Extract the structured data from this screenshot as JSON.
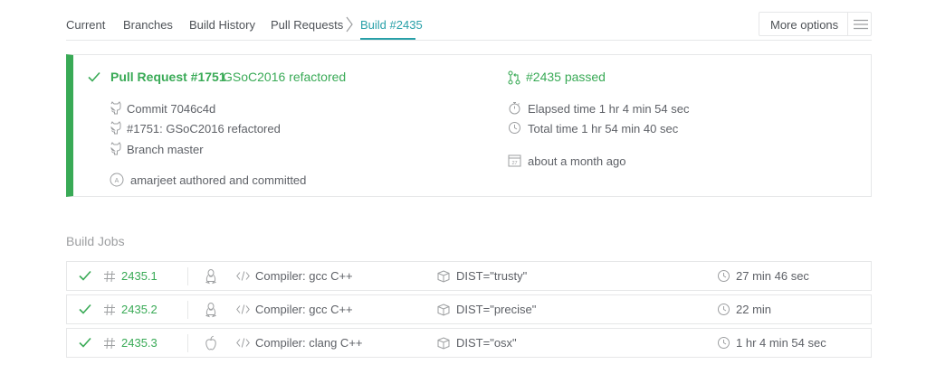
{
  "nav": {
    "tabs": [
      {
        "label": "Current"
      },
      {
        "label": "Branches"
      },
      {
        "label": "Build History"
      },
      {
        "label": "Pull Requests"
      },
      {
        "label": "Build #2435"
      }
    ],
    "active_tab": "Build #2435",
    "more_options_label": "More options"
  },
  "build": {
    "pr_number": "Pull Request #1751",
    "pr_message": "GSoC2016 refactored",
    "commit": "Commit 7046c4d",
    "pr_ref": "#1751: GSoC2016 refactored",
    "branch": "Branch master",
    "author": "amarjeet authored and committed",
    "status": "#2435 passed",
    "elapsed": "Elapsed time 1 hr 4 min 54 sec",
    "total": "Total time 1 hr 54 min 40 sec",
    "when": "about a month ago",
    "author_avatar_letter": "A",
    "calendar_day": "27"
  },
  "jobs_heading": "Build Jobs",
  "jobs": [
    {
      "number": "2435.1",
      "os": "linux",
      "compiler": "Compiler: gcc C++",
      "env": "DIST=\"trusty\"",
      "duration": "27 min 46 sec",
      "state": "passed"
    },
    {
      "number": "2435.2",
      "os": "linux",
      "compiler": "Compiler: gcc C++",
      "env": "DIST=\"precise\"",
      "duration": "22 min",
      "state": "passed"
    },
    {
      "number": "2435.3",
      "os": "osx",
      "compiler": "Compiler: clang C++",
      "env": "DIST=\"osx\"",
      "duration": "1 hr 4 min 54 sec",
      "state": "passed"
    }
  ],
  "colors": {
    "passed": "#39aa56",
    "accent": "#28a0a8",
    "border": "#e6e7e8",
    "text": "#5e6167",
    "muted": "#9d9fa1"
  }
}
